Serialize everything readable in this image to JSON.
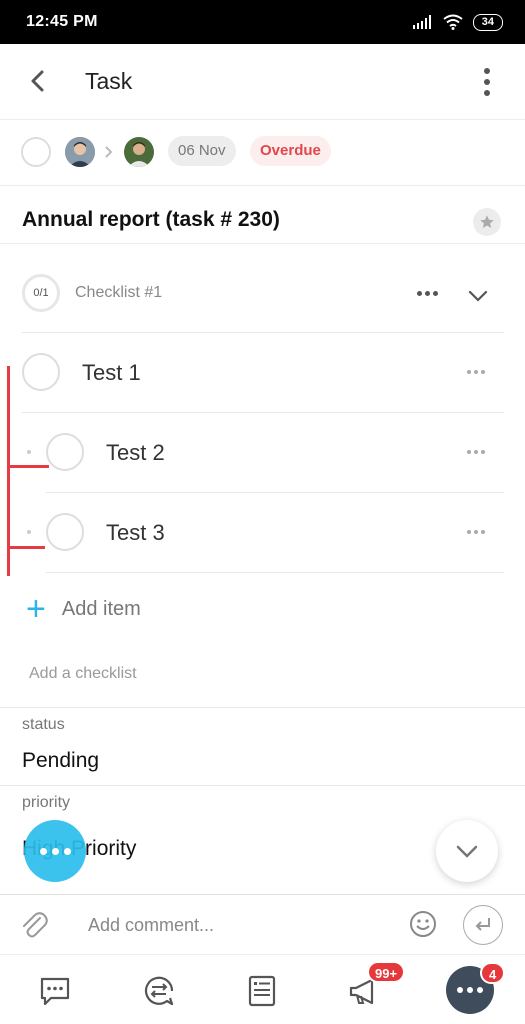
{
  "status_bar": {
    "time": "12:45 PM",
    "battery": "34"
  },
  "header": {
    "title": "Task"
  },
  "meta": {
    "due_date": "06 Nov",
    "state": "Overdue"
  },
  "task": {
    "title": "Annual report (task # 230)"
  },
  "checklist": {
    "progress": "0/1",
    "name": "Checklist #1",
    "items": [
      {
        "label": "Test 1"
      },
      {
        "label": "Test 2"
      },
      {
        "label": "Test 3"
      }
    ],
    "add_item_label": "Add item",
    "add_checklist_label": "Add a checklist"
  },
  "fields": {
    "status_label": "status",
    "status_value": "Pending",
    "priority_label": "priority",
    "priority_value": "High Priority"
  },
  "comment": {
    "placeholder": "Add comment..."
  },
  "bottom_nav": {
    "notifications_badge": "99+",
    "more_badge": "4"
  },
  "colors": {
    "accent": "#2db4e6",
    "overdue": "#e2474b",
    "annotation": "#e53c44",
    "badge": "#e5383b"
  }
}
